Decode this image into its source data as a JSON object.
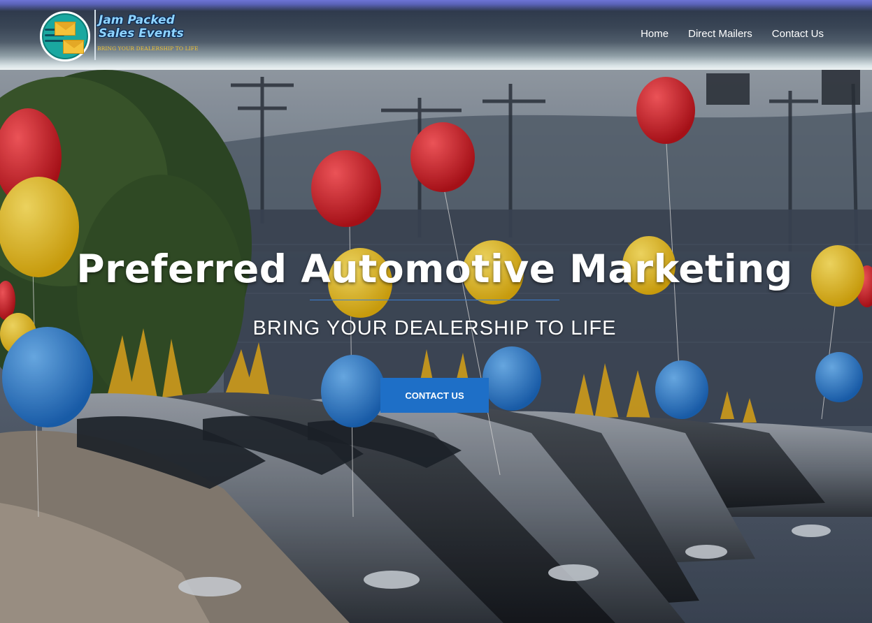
{
  "logo": {
    "title_line1": "Jam Packed",
    "title_line2": "Sales Events",
    "tagline": "BRING YOUR DEALERSHIP TO LIFE"
  },
  "nav": {
    "items": [
      {
        "label": "Home"
      },
      {
        "label": "Direct Mailers"
      },
      {
        "label": "Contact Us"
      }
    ]
  },
  "hero": {
    "headline": "Preferred Automotive Marketing",
    "subheadline": "BRING YOUR DEALERSHIP TO LIFE",
    "cta_label": "CONTACT US",
    "balloon_colors": {
      "red": "#d21f25",
      "yellow": "#f1c81c",
      "blue": "#2f86d8"
    }
  },
  "colors": {
    "accent": "#1e6fc7",
    "header_top": "#6e74d6"
  }
}
